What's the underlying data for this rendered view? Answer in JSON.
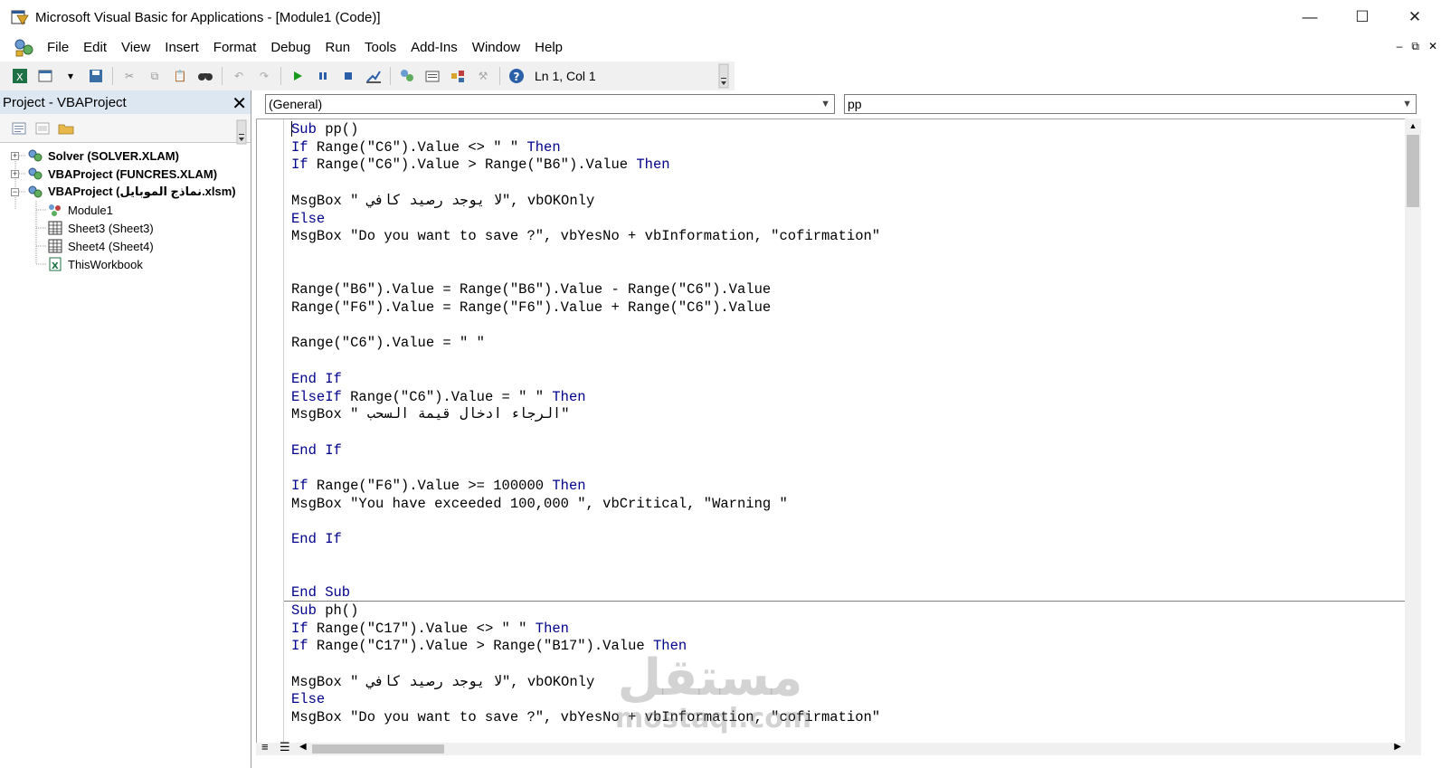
{
  "window": {
    "title": "Microsoft Visual Basic for Applications - [Module1 (Code)]",
    "controls": [
      "—",
      "☐",
      "✕"
    ],
    "mdi_controls": [
      "–",
      "⧉",
      "✕"
    ]
  },
  "menu": [
    {
      "label": "File"
    },
    {
      "label": "Edit"
    },
    {
      "label": "View"
    },
    {
      "label": "Insert"
    },
    {
      "label": "Format"
    },
    {
      "label": "Debug"
    },
    {
      "label": "Run"
    },
    {
      "label": "Tools"
    },
    {
      "label": "Add-Ins"
    },
    {
      "label": "Window"
    },
    {
      "label": "Help"
    }
  ],
  "toolbar": {
    "status": "Ln 1, Col 1"
  },
  "project_pane": {
    "title": "Project - VBAProject",
    "close_glyph": "✕",
    "tree": [
      {
        "label": "Solver (SOLVER.XLAM)"
      },
      {
        "label": "VBAProject (FUNCRES.XLAM)"
      },
      {
        "label": "VBAProject (نماذج الموبايل.xlsm)"
      },
      {
        "label": "Module1"
      },
      {
        "label": "Sheet3 (Sheet3)"
      },
      {
        "label": "Sheet4 (Sheet4)"
      },
      {
        "label": "ThisWorkbook"
      }
    ]
  },
  "editor": {
    "object_combo": "(General)",
    "procedure_combo": "pp",
    "code_lines": [
      "Sub pp()",
      "If Range(\"C6\").Value <> \" \" Then",
      "If Range(\"C6\").Value > Range(\"B6\").Value Then",
      "",
      "MsgBox \" لا يوجد رصيد كافي\", vbOKOnly",
      "Else",
      "MsgBox \"Do you want to save ?\", vbYesNo + vbInformation, \"cofirmation\"",
      "",
      "",
      "Range(\"B6\").Value = Range(\"B6\").Value - Range(\"C6\").Value",
      "Range(\"F6\").Value = Range(\"F6\").Value + Range(\"C6\").Value",
      "",
      "Range(\"C6\").Value = \" \"",
      "",
      "End If",
      "ElseIf Range(\"C6\").Value = \" \" Then",
      "MsgBox \" الرجاء ادخال قيمة السحب\"",
      "",
      "End If",
      "",
      "If Range(\"F6\").Value >= 100000 Then",
      "MsgBox \"You have exceeded 100,000 \", vbCritical, \"Warning \"",
      "",
      "End If",
      "",
      "",
      "End Sub",
      "Sub ph()",
      "If Range(\"C17\").Value <> \" \" Then",
      "If Range(\"C17\").Value > Range(\"B17\").Value Then",
      "",
      "MsgBox \" لا يوجد رصيد كافي\", vbOKOnly",
      "Else",
      "MsgBox \"Do you want to save ?\", vbYesNo + vbInformation, \"cofirmation\""
    ]
  },
  "watermark": {
    "arabic": "مستقل",
    "latin": "mostaql.com"
  },
  "colors": {
    "keyword": "#00008b",
    "pane_header": "#dde7f1",
    "toolbar_bg": "#f0f0f0"
  }
}
